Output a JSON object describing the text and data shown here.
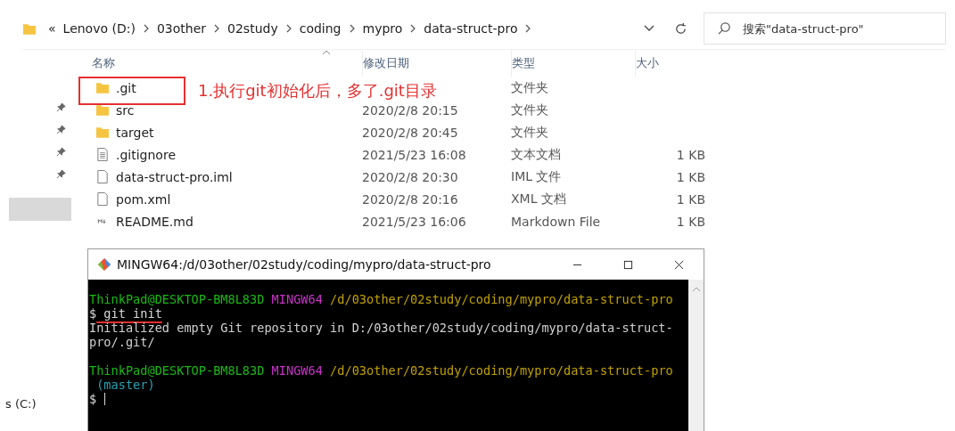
{
  "address_bar": {
    "overflow": "«",
    "breadcrumbs": [
      "Lenovo (D:)",
      "03other",
      "02study",
      "coding",
      "mypro",
      "data-struct-pro"
    ]
  },
  "search": {
    "placeholder": "搜索\"data-struct-pro\""
  },
  "columns": [
    "名称",
    "修改日期",
    "类型",
    "大小"
  ],
  "files": [
    {
      "kind": "folder",
      "name": ".git",
      "type": "文件夹"
    },
    {
      "kind": "folder",
      "name": "src",
      "modified": "2020/2/8 20:15",
      "type": "文件夹"
    },
    {
      "kind": "folder",
      "name": "target",
      "modified": "2020/2/8 20:45",
      "type": "文件夹"
    },
    {
      "kind": "text",
      "name": ".gitignore",
      "modified": "2021/5/23 16:08",
      "type": "文本文档",
      "size": "1 KB"
    },
    {
      "kind": "file",
      "name": "data-struct-pro.iml",
      "modified": "2020/2/8 20:30",
      "type": "IML 文件",
      "size": "1 KB"
    },
    {
      "kind": "file",
      "name": "pom.xml",
      "modified": "2020/2/8 20:16",
      "type": "XML 文档",
      "size": "1 KB"
    },
    {
      "kind": "markdown",
      "name": "README.md",
      "modified": "2021/5/23 16:06",
      "type": "Markdown File",
      "size": "1 KB"
    }
  ],
  "annotation": {
    "text": "1.执行git初始化后，多了.git目录"
  },
  "nav": {
    "drive": "s (C:)"
  },
  "terminal": {
    "title": "MINGW64:/d/03other/02study/coding/mypro/data-struct-pro",
    "lines": [
      {
        "segments": [
          {
            "kind": "user",
            "text": "ThinkPad@DESKTOP-BM8L83D"
          },
          {
            "kind": "host",
            "text": " MINGW64"
          },
          {
            "kind": "path",
            "text": " /d/03other/02study/coding/mypro/data-struct-pro"
          }
        ]
      },
      {
        "segments": [
          {
            "kind": "prompt",
            "text": "$"
          },
          {
            "kind": "command",
            "text": " git init"
          }
        ]
      },
      {
        "segments": [
          {
            "kind": "output",
            "text": "Initialized empty Git repository in D:/03other/02study/coding/mypro/data-struct-"
          }
        ]
      },
      {
        "segments": [
          {
            "kind": "output",
            "text": "pro/.git/"
          }
        ]
      },
      {
        "kind": "blank"
      },
      {
        "segments": [
          {
            "kind": "user",
            "text": "ThinkPad@DESKTOP-BM8L83D"
          },
          {
            "kind": "host",
            "text": " MINGW64"
          },
          {
            "kind": "path",
            "text": " /d/03other/02study/coding/mypro/data-struct-pro"
          }
        ]
      },
      {
        "segments": [
          {
            "kind": "branch",
            "text": " (master)"
          }
        ]
      },
      {
        "segments": [
          {
            "kind": "prompt",
            "text": "$"
          }
        ],
        "cursor": true
      }
    ]
  }
}
